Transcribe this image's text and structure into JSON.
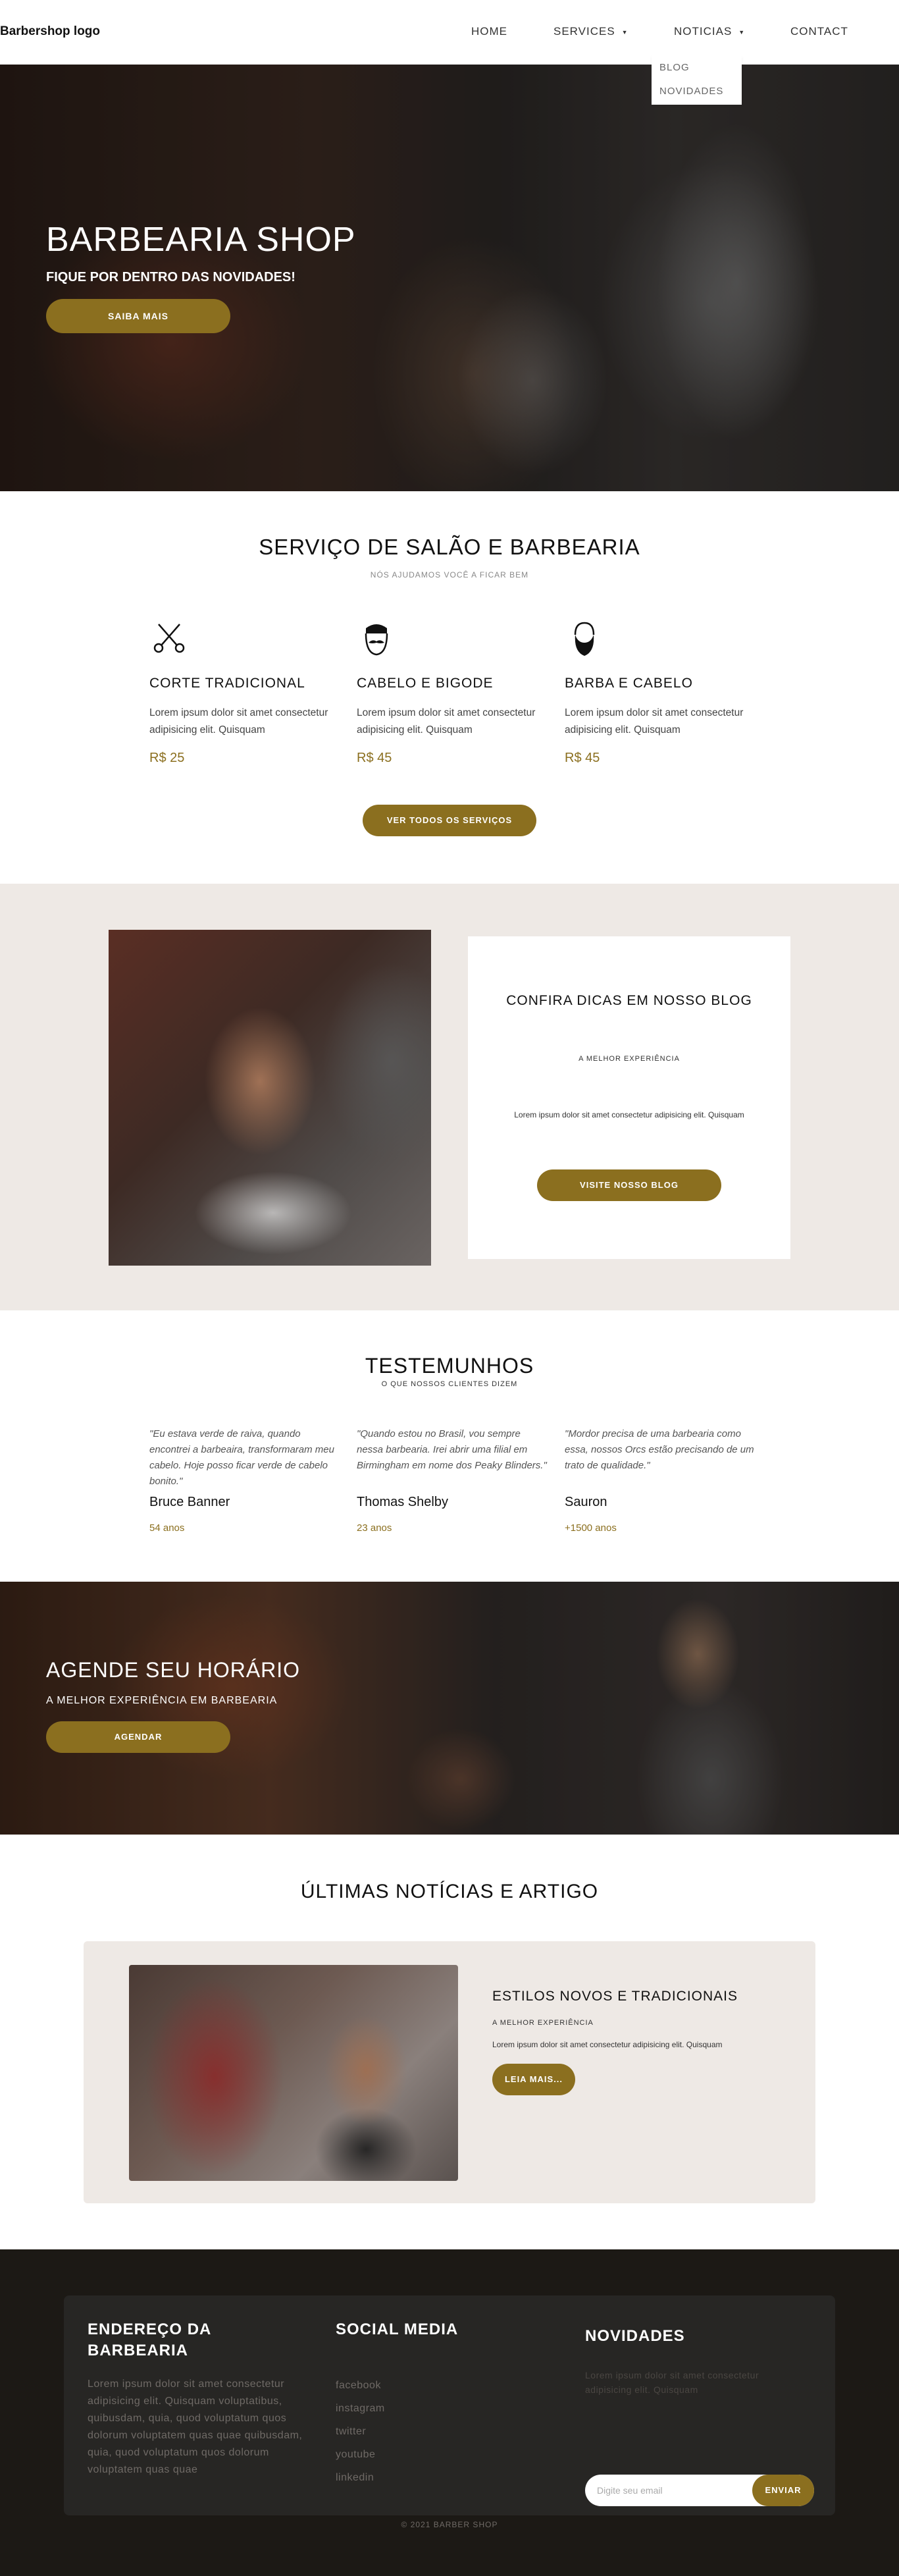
{
  "nav": {
    "logo": "Barbershop logo",
    "home": "HOME",
    "services": "SERVICES",
    "noticias": "NOTICIAS",
    "contact": "CONTACT",
    "dropdown": [
      "BLOG",
      "NOVIDADES"
    ]
  },
  "hero": {
    "title": "BARBEARIA SHOP",
    "subtitle": "FIQUE POR DENTRO DAS NOVIDADES!",
    "button": "SAIBA MAIS"
  },
  "services": {
    "title": "SERVIÇO DE SALÃO E BARBEARIA",
    "subtitle": "NÓS AJUDAMOS VOCÊ A FICAR BEM",
    "items": [
      {
        "icon": "scissors-icon",
        "name": "CORTE TRADICIONAL",
        "desc": "Lorem ipsum dolor sit amet consectetur adipisicing elit. Quisquam",
        "price": "R$ 25"
      },
      {
        "icon": "mustache-face-icon",
        "name": "CABELO E BIGODE",
        "desc": "Lorem ipsum dolor sit amet consectetur adipisicing elit. Quisquam",
        "price": "R$ 45"
      },
      {
        "icon": "beard-face-icon",
        "name": "BARBA E CABELO",
        "desc": "Lorem ipsum dolor sit amet consectetur adipisicing elit. Quisquam",
        "price": "R$ 45"
      }
    ],
    "button": "VER TODOS OS SERVIÇOS"
  },
  "blog_promo": {
    "title": "CONFIRA DICAS EM NOSSO BLOG",
    "subtitle": "A MELHOR EXPERIÊNCIA",
    "desc": "Lorem ipsum dolor sit amet consectetur adipisicing elit. Quisquam",
    "button": "VISITE NOSSO BLOG"
  },
  "testimonials": {
    "title": "TESTEMUNHOS",
    "subtitle": "O QUE NOSSOS CLIENTES DIZEM",
    "items": [
      {
        "quote": "\"Eu estava verde de raiva, quando encontrei a barbeaira, transformaram meu cabelo. Hoje posso ficar verde de cabelo bonito.\"",
        "name": "Bruce Banner",
        "age": "54 anos"
      },
      {
        "quote": "\"Quando estou no Brasil, vou sempre nessa barbearia. Irei abrir uma filial em Birmingham em nome dos Peaky Blinders.\"",
        "name": "Thomas Shelby",
        "age": "23 anos"
      },
      {
        "quote": "\"Mordor precisa de uma barbearia como essa, nossos Orcs estão precisando de um trato de qualidade.\"",
        "name": "Sauron",
        "age": "+1500 anos"
      }
    ]
  },
  "schedule": {
    "title": "AGENDE SEU HORÁRIO",
    "subtitle": "A MELHOR EXPERIÊNCIA EM BARBEARIA",
    "button": "AGENDAR"
  },
  "news": {
    "section_title": "ÚLTIMAS NOTÍCIAS E ARTIGO",
    "title": "ESTILOS NOVOS E TRADICIONAIS",
    "subtitle": "A MELHOR EXPERIÊNCIA",
    "desc": "Lorem ipsum dolor sit amet consectetur adipisicing elit. Quisquam",
    "button": "LEIA MAIS..."
  },
  "footer": {
    "address_title": "ENDEREÇO DA BARBEARIA",
    "address_text": "Lorem ipsum dolor sit amet consectetur adipisicing elit. Quisquam voluptatibus, quibusdam, quia, quod voluptatum quos dolorum voluptatem quas quae quibusdam, quia, quod voluptatum quos dolorum voluptatem quas quae",
    "social_title": "SOCIAL MEDIA",
    "social_links": [
      "facebook",
      "instagram",
      "twitter",
      "youtube",
      "linkedin"
    ],
    "news_title": "NOVIDADES",
    "news_text": "Lorem ipsum dolor sit amet consectetur adipisicing elit. Quisquam",
    "email_placeholder": "Digite seu email",
    "email_button": "ENVIAR",
    "copyright": "© 2021 BARBER SHOP"
  },
  "colors": {
    "accent": "#8b6f1f",
    "section_bg": "#eee9e5",
    "footer_bg": "#1c1915",
    "footer_box": "#272624"
  }
}
